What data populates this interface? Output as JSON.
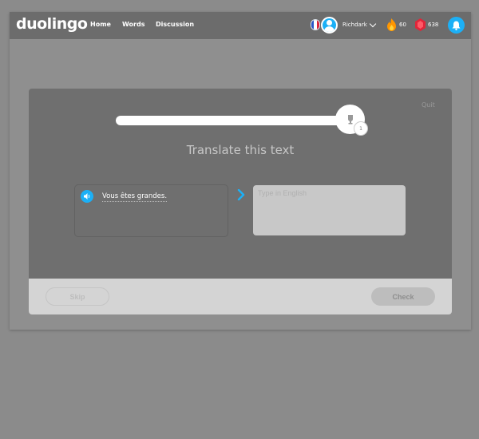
{
  "app": {
    "logo_text": "duolingo"
  },
  "nav": {
    "links": [
      "Home",
      "Words",
      "Discussion"
    ]
  },
  "user": {
    "language_flag_icon": "french-flag-icon",
    "avatar_icon": "user-avatar-icon",
    "name": "Richdark",
    "dropdown_icon": "chevron-down-icon",
    "streak": "60",
    "streak_icon": "flame-icon",
    "gems": "638",
    "gems_icon": "red-gem-icon",
    "notifications_icon": "bell-icon"
  },
  "lesson": {
    "quit_label": "Quit",
    "progress_fraction": 0.97,
    "progress_badge_icon": "trophy-icon",
    "progress_count": "1",
    "title": "Translate this text",
    "source_text": "Vous êtes grandes.",
    "speaker_icon": "speaker-icon",
    "arrow_icon": "chevron-right-icon",
    "answer_placeholder": "Type in English",
    "answer_value": ""
  },
  "footer": {
    "skip_label": "Skip",
    "check_label": "Check"
  },
  "colors": {
    "accent_blue": "#1cb0f6",
    "flame_orange": "#ff9600",
    "gem_red": "#e0263a",
    "overlay_gray": "#8f8f8f",
    "panel_gray": "#6f6f6f",
    "footer_gray": "#d4d4d4"
  }
}
